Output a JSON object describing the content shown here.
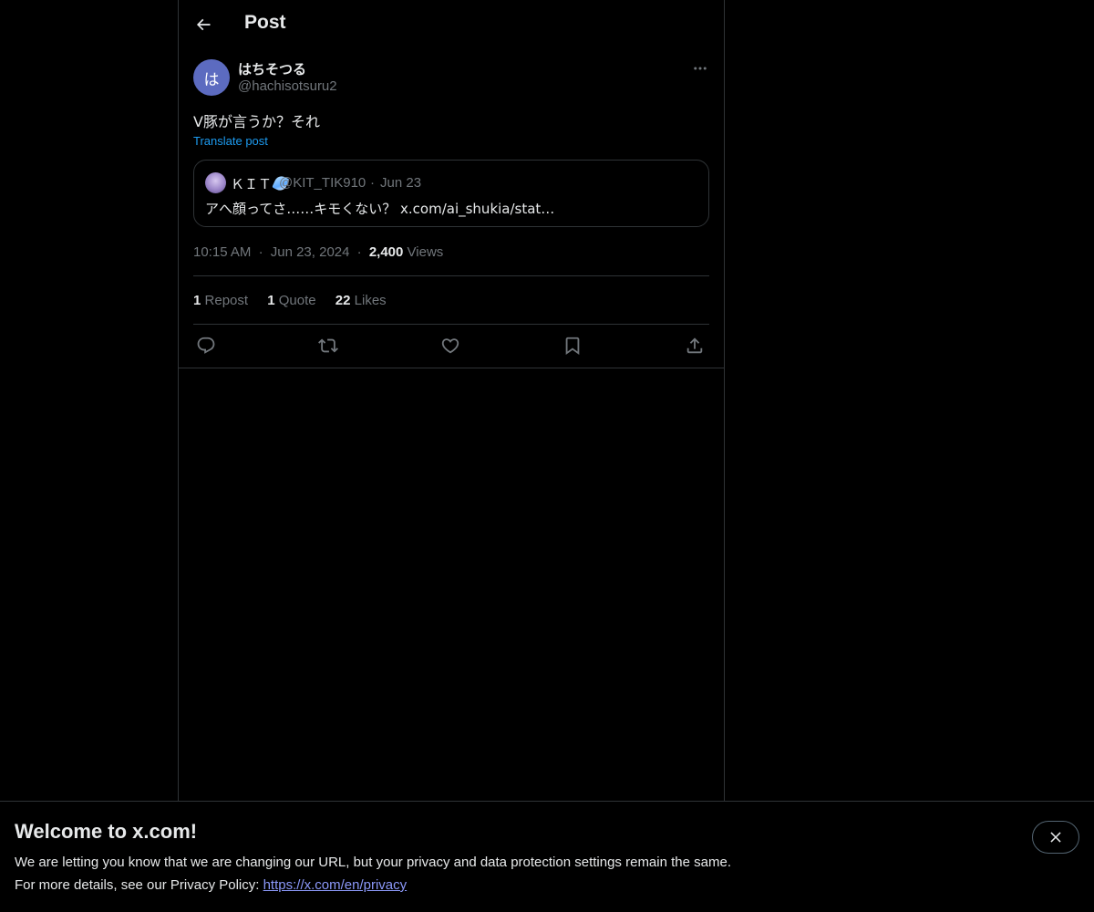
{
  "header": {
    "title": "Post",
    "back_icon": "arrow-left-icon"
  },
  "post": {
    "author": {
      "avatar_text": "は",
      "avatar_color": "#5c6bc0",
      "display_name": "はちそつる",
      "handle": "@hachisotsuru2"
    },
    "more_icon": "more-horizontal-icon",
    "text": "V豚が言うか？それ",
    "translate_label": "Translate post",
    "quote": {
      "display_name": "ＫＩＴ",
      "handle": "@KIT_TIK910",
      "separator": "·",
      "date": "Jun 23",
      "text": "アへ顔ってさ……キモくない？ x.com/ai_shukia/stat…"
    },
    "time": "10:15 AM",
    "meta_separator": "·",
    "date": "Jun 23, 2024",
    "views_count": "2,400",
    "views_label": "Views",
    "stats": {
      "reposts_count": "1",
      "reposts_label": "Repost",
      "quotes_count": "1",
      "quotes_label": "Quote",
      "likes_count": "22",
      "likes_label": "Likes"
    },
    "actions": [
      {
        "name": "reply",
        "icon": "reply-icon"
      },
      {
        "name": "repost",
        "icon": "repost-icon"
      },
      {
        "name": "like",
        "icon": "heart-icon"
      },
      {
        "name": "bookmark",
        "icon": "bookmark-icon"
      },
      {
        "name": "share",
        "icon": "share-icon"
      }
    ]
  },
  "banner": {
    "title": "Welcome to x.com!",
    "line1": "We are letting you know that we are changing our URL, but your privacy and data protection settings remain the same.",
    "line2_prefix": "For more details, see our Privacy Policy: ",
    "link_text": "https://x.com/en/privacy",
    "close_icon": "close-icon"
  },
  "colors": {
    "background": "#000000",
    "text_primary": "#e7e9ea",
    "text_secondary": "#71767b",
    "accent": "#1d9bf0",
    "border": "#2f3336",
    "link": "#8b98f9"
  }
}
